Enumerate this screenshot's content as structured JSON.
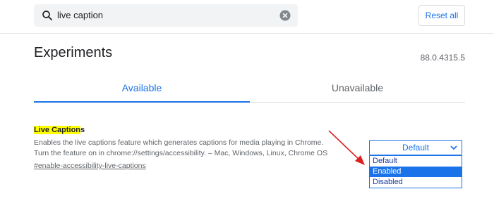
{
  "header": {
    "search_value": "live caption",
    "reset_label": "Reset all"
  },
  "page": {
    "title": "Experiments",
    "version": "88.0.4315.5"
  },
  "tabs": [
    {
      "label": "Available",
      "active": true
    },
    {
      "label": "Unavailable",
      "active": false
    }
  ],
  "experiment": {
    "title_highlight": "Live Caption",
    "title_rest": "s",
    "desc_line1": "Enables the live captions feature which generates captions for media playing in Chrome.",
    "desc_line2": "Turn the feature on in chrome://settings/accessibility. – Mac, Windows, Linux, Chrome OS",
    "link": "#enable-accessibility-live-captions",
    "select_value": "Default",
    "options": [
      "Default",
      "Enabled",
      "Disabled"
    ],
    "selected_option": "Enabled"
  },
  "colors": {
    "accent": "#1a73e8",
    "highlight": "#ffff00",
    "annotation_arrow": "#e02020"
  },
  "icons": {
    "search": "search-icon",
    "clear": "clear-icon",
    "dropdown": "chevron-down-icon"
  }
}
